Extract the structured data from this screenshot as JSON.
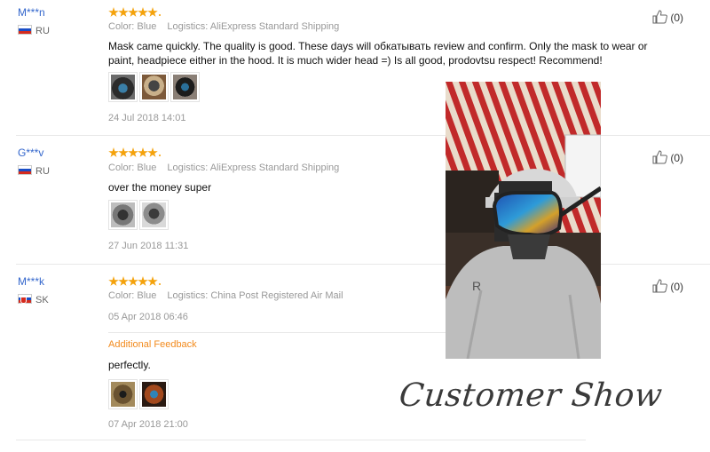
{
  "reviews": [
    {
      "user": "M***n",
      "country": "RU",
      "color": "Color: Blue",
      "logistics": "Logistics: AliExpress Standard Shipping",
      "text": "Mask came quickly. The quality is good. These days will обкатывать review and confirm. Only the mask to wear or paint, headpiece either in the hood. It is much wider head =) Is all good, prodovtsu respect! Recommend!",
      "date": "24 Jul 2018 14:01",
      "helpful": "(0)",
      "rating": 5,
      "photo_count": 3
    },
    {
      "user": "G***v",
      "country": "RU",
      "color": "Color: Blue",
      "logistics": "Logistics: AliExpress Standard Shipping",
      "text": "over the money super",
      "date": "27 Jun 2018 11:31",
      "helpful": "(0)",
      "rating": 5,
      "photo_count": 2
    },
    {
      "user": "M***k",
      "country": "SK",
      "color": "Color: Blue",
      "logistics": "Logistics: China Post Registered Air Mail",
      "date": "05 Apr 2018 06:46",
      "additional_feedback_label": "Additional Feedback",
      "additional_text": "perfectly.",
      "additional_date": "07 Apr 2018 21:00",
      "helpful": "(0)",
      "rating": 5,
      "photo_count": 2
    }
  ],
  "customer_show": "Customer Show",
  "colors": {
    "link": "#3366cc",
    "star": "#f4a20b",
    "additional_feedback": "#f28a1c"
  }
}
